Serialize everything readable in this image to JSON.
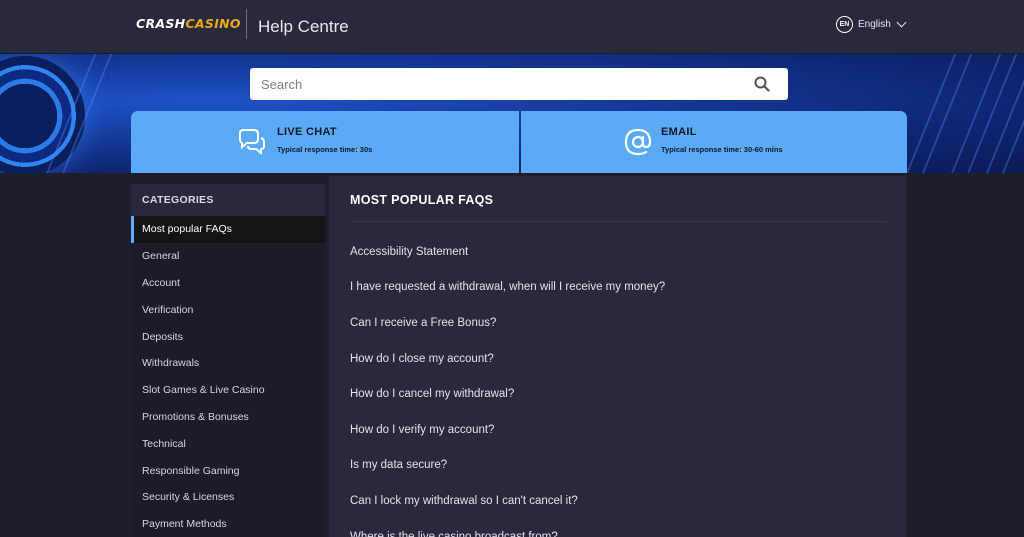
{
  "header": {
    "logo": {
      "part1": "CRASH",
      "part2": "CASINO"
    },
    "title": "Help Centre",
    "language": {
      "code": "EN",
      "label": "English"
    }
  },
  "search": {
    "placeholder": "Search"
  },
  "contact": {
    "live_chat": {
      "title": "LIVE CHAT",
      "subtitle": "Typical response time: 30s"
    },
    "email": {
      "title": "EMAIL",
      "subtitle": "Typical response time: 30-60 mins"
    }
  },
  "sidebar": {
    "heading": "CATEGORIES",
    "items": [
      {
        "label": "Most popular FAQs"
      },
      {
        "label": "General"
      },
      {
        "label": "Account"
      },
      {
        "label": "Verification"
      },
      {
        "label": "Deposits"
      },
      {
        "label": "Withdrawals"
      },
      {
        "label": "Slot Games & Live Casino"
      },
      {
        "label": "Promotions & Bonuses"
      },
      {
        "label": "Technical"
      },
      {
        "label": "Responsible Gaming"
      },
      {
        "label": "Security & Licenses"
      },
      {
        "label": "Payment Methods"
      }
    ]
  },
  "main": {
    "title": "MOST POPULAR FAQS",
    "faqs": [
      {
        "question": "Accessibility Statement"
      },
      {
        "question": "I have requested a withdrawal, when will I receive my money?"
      },
      {
        "question": "Can I receive a Free Bonus?"
      },
      {
        "question": "How do I close my account?"
      },
      {
        "question": "How do I cancel my withdrawal?"
      },
      {
        "question": "How do I verify my account?"
      },
      {
        "question": "Is my data secure?"
      },
      {
        "question": "Can I lock my withdrawal so I can't cancel it?"
      },
      {
        "question": "Where is the live casino broadcast from?"
      }
    ]
  },
  "colors": {
    "header_bg": "#262a3a",
    "page_bg": "#1c1f2b",
    "card_blue": "#5aaaf6",
    "logo_accent": "#f2a51a",
    "banner_blue": "#163a9c"
  },
  "icons": {
    "search": "search-icon",
    "chat": "chat-bubbles-icon",
    "email": "at-sign-icon",
    "language": "chevron-down-icon"
  }
}
